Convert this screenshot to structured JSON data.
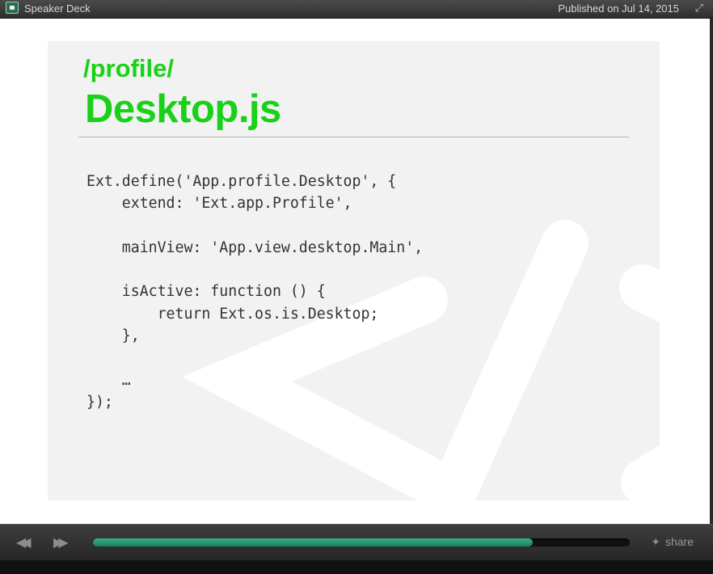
{
  "header": {
    "brand": "Speaker Deck",
    "published": "Published on Jul 14, 2015",
    "expand_icon": "expand-icon"
  },
  "slide": {
    "subtitle": "/profile/",
    "title": "Desktop.js",
    "code_lines": [
      "Ext.define('App.profile.Desktop', {",
      "    extend: 'Ext.app.Profile',",
      "",
      "    mainView: 'App.view.desktop.Main',",
      "",
      "    isActive: function () {",
      "        return Ext.os.is.Desktop;",
      "    },",
      "",
      "    …",
      "});"
    ],
    "accent_color": "#19d119"
  },
  "player": {
    "progress": 0.82,
    "share_label": "share",
    "prev_icon": "rewind-icon",
    "next_icon": "fast-forward-icon",
    "share_icon": "twitter-bird-icon",
    "progress_color": "#2a9b77"
  }
}
